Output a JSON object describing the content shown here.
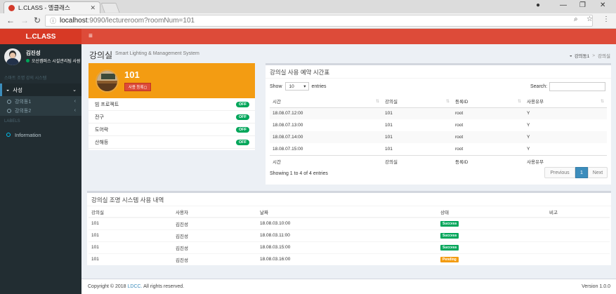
{
  "browser": {
    "tab_title": "L.CLASS - 엘클래스",
    "url_host": "localhost",
    "url_path": ":9090/lectureroom?roomNum=101"
  },
  "sidebar": {
    "logo": "L.CLASS",
    "user_name": "김진성",
    "user_role": "오산캠퍼스 시설관리팀 사원",
    "section_title": "스마트 조명 강의 시스템",
    "menu_active": "사성",
    "sub_items": [
      "강의동1",
      "강의동2"
    ],
    "labels_header": "LABELS",
    "info_item": "Information"
  },
  "page": {
    "title": "강의실",
    "subtitle": "Smart Lighting & Management System",
    "breadcrumb": [
      "강의동1",
      "강의실"
    ]
  },
  "room": {
    "number": "101",
    "book_button": "사용 등록◻",
    "devices": [
      {
        "name": "빔 프로젝트",
        "state": "OFF"
      },
      {
        "name": "전구",
        "state": "OFF"
      },
      {
        "name": "도어락",
        "state": "OFF"
      },
      {
        "name": "산해등",
        "state": "OFF"
      }
    ]
  },
  "schedule": {
    "title": "강의실 사용 예약 시간표",
    "show_label": "Show",
    "entries_value": "10",
    "entries_label": "entries",
    "search_label": "Search:",
    "columns": [
      "시간",
      "강의실",
      "등록ID",
      "사용유무"
    ],
    "rows": [
      [
        "18.08.07.12:00",
        "101",
        "root",
        "Y"
      ],
      [
        "18.08.07.13:00",
        "101",
        "root",
        "Y"
      ],
      [
        "18.08.07.14:00",
        "101",
        "root",
        "Y"
      ],
      [
        "18.08.07.15:00",
        "101",
        "root",
        "Y"
      ]
    ],
    "footer_columns": [
      "시간",
      "강의실",
      "등록ID",
      "사용유무"
    ],
    "info": "Showing 1 to 4 of 4 entries",
    "pager": {
      "prev": "Previous",
      "page": "1",
      "next": "Next"
    }
  },
  "history": {
    "title": "강의실 조명 시스템 사용 내역",
    "columns": [
      "강의실",
      "사용자",
      "날짜",
      "상태",
      "비고"
    ],
    "rows": [
      {
        "room": "101",
        "user": "김진성",
        "date": "18.08.03.10:00",
        "status": "Success",
        "status_color": "#00a65a"
      },
      {
        "room": "101",
        "user": "김진성",
        "date": "18.08.03.11:00",
        "status": "Success",
        "status_color": "#00a65a"
      },
      {
        "room": "101",
        "user": "김진성",
        "date": "18.08.03.15:00",
        "status": "Success",
        "status_color": "#00a65a"
      },
      {
        "room": "101",
        "user": "김진성",
        "date": "18.08.03.16:00",
        "status": "Pending",
        "status_color": "#f39c12"
      }
    ]
  },
  "footer": {
    "copyright": "Copyright © 2018",
    "company": "LDCC.",
    "rights": "All rights reserved.",
    "version": "Version 1.0.0"
  },
  "colors": {
    "header_red": "#dd4b39",
    "logo_red": "#d73925",
    "sidebar_dark": "#222d32",
    "room_orange": "#f39c12",
    "success_green": "#00a65a",
    "primary_blue": "#3c8dbc"
  }
}
